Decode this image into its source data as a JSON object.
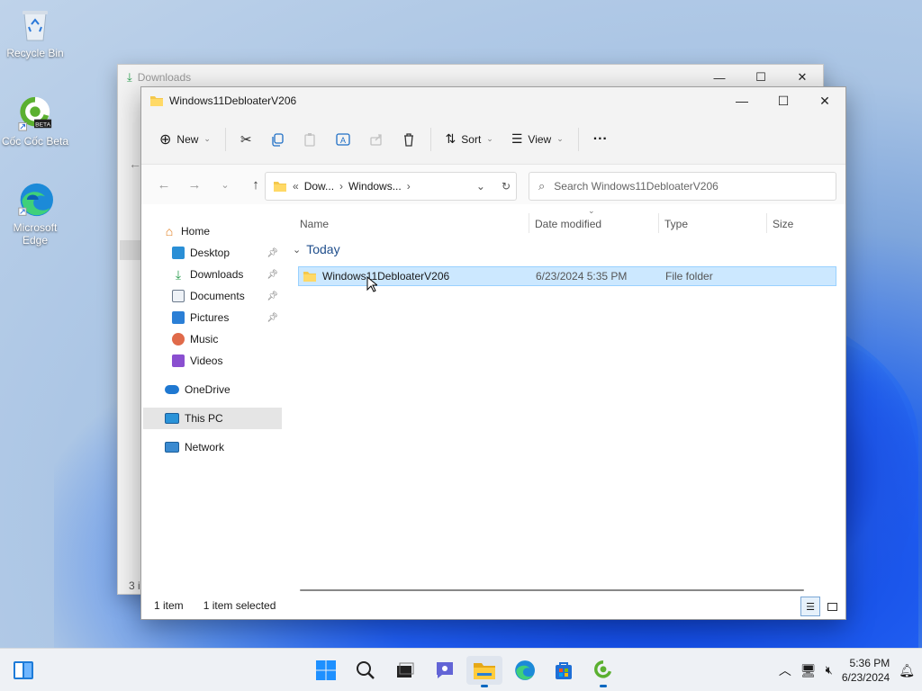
{
  "desktop": {
    "icons": [
      {
        "label": "Recycle Bin"
      },
      {
        "label": "Cốc Cốc Beta",
        "badge": "BETA"
      },
      {
        "label": "Microsoft Edge"
      }
    ]
  },
  "background_window": {
    "title": "Downloads",
    "status_fragment": "3 i"
  },
  "window": {
    "title": "Windows11DebloaterV206",
    "controls": {
      "minimize": "—",
      "maximize": "☐",
      "close": "✕"
    }
  },
  "toolbar": {
    "new_label": "New",
    "sort_label": "Sort",
    "view_label": "View",
    "more_label": "···"
  },
  "address": {
    "prefix": "«",
    "crumb1": "Dow...",
    "crumb2": "Windows...",
    "separator": "›"
  },
  "search": {
    "placeholder": "Search Windows11DebloaterV206"
  },
  "nav": {
    "items": [
      {
        "label": "Home"
      },
      {
        "label": "Desktop"
      },
      {
        "label": "Downloads"
      },
      {
        "label": "Documents"
      },
      {
        "label": "Pictures"
      },
      {
        "label": "Music"
      },
      {
        "label": "Videos"
      },
      {
        "label": "OneDrive"
      },
      {
        "label": "This PC"
      },
      {
        "label": "Network"
      }
    ]
  },
  "columns": {
    "name": "Name",
    "date": "Date modified",
    "type": "Type",
    "size": "Size"
  },
  "group": {
    "label": "Today"
  },
  "files": [
    {
      "name": "Windows11DebloaterV206",
      "date": "6/23/2024 5:35 PM",
      "type": "File folder",
      "size": ""
    }
  ],
  "status": {
    "count": "1 item",
    "selection": "1 item selected"
  },
  "taskbar": {
    "time": "5:36 PM",
    "date": "6/23/2024"
  },
  "colors": {
    "accent": "#0067c0",
    "selection": "#cce8ff",
    "folder": "#f4c84c"
  }
}
